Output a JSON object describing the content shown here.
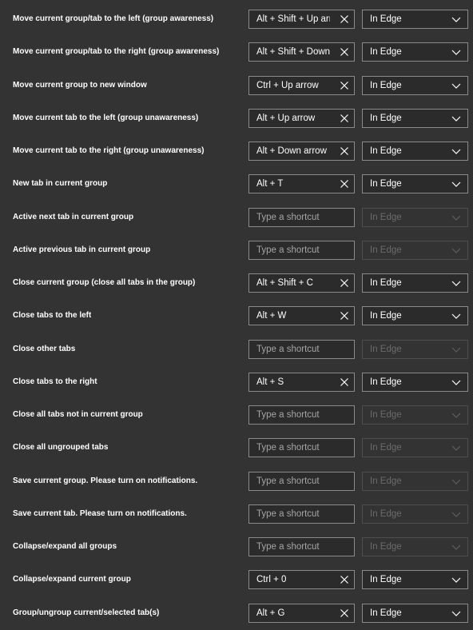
{
  "shortcuts": [
    {
      "label": "Move current group/tab to the left (group awareness)",
      "keys": "Alt + Shift + Up arr",
      "placeholder": "",
      "scope": "In Edge",
      "enabled": true
    },
    {
      "label": "Move current group/tab to the right (group awareness)",
      "keys": "Alt + Shift + Down",
      "placeholder": "",
      "scope": "In Edge",
      "enabled": true
    },
    {
      "label": "Move current group to new window",
      "keys": "Ctrl + Up arrow",
      "placeholder": "",
      "scope": "In Edge",
      "enabled": true
    },
    {
      "label": "Move current tab to the left (group unawareness)",
      "keys": "Alt + Up arrow",
      "placeholder": "",
      "scope": "In Edge",
      "enabled": true
    },
    {
      "label": "Move current tab to the right (group unawareness)",
      "keys": "Alt + Down arrow",
      "placeholder": "",
      "scope": "In Edge",
      "enabled": true
    },
    {
      "label": "New tab in current group",
      "keys": "Alt + T",
      "placeholder": "",
      "scope": "In Edge",
      "enabled": true
    },
    {
      "label": "Active next tab in current group",
      "keys": "",
      "placeholder": "Type a shortcut",
      "scope": "In Edge",
      "enabled": false
    },
    {
      "label": "Active previous tab in current group",
      "keys": "",
      "placeholder": "Type a shortcut",
      "scope": "In Edge",
      "enabled": false
    },
    {
      "label": "Close current group (close all tabs in the group)",
      "keys": "Alt + Shift + C",
      "placeholder": "",
      "scope": "In Edge",
      "enabled": true
    },
    {
      "label": "Close tabs to the left",
      "keys": "Alt + W",
      "placeholder": "",
      "scope": "In Edge",
      "enabled": true
    },
    {
      "label": "Close other tabs",
      "keys": "",
      "placeholder": "Type a shortcut",
      "scope": "In Edge",
      "enabled": false
    },
    {
      "label": "Close tabs to the right",
      "keys": "Alt + S",
      "placeholder": "",
      "scope": "In Edge",
      "enabled": true
    },
    {
      "label": "Close all tabs not in current group",
      "keys": "",
      "placeholder": "Type a shortcut",
      "scope": "In Edge",
      "enabled": false
    },
    {
      "label": "Close all ungrouped tabs",
      "keys": "",
      "placeholder": "Type a shortcut",
      "scope": "In Edge",
      "enabled": false
    },
    {
      "label": "Save current group. Please turn on notifications.",
      "keys": "",
      "placeholder": "Type a shortcut",
      "scope": "In Edge",
      "enabled": false
    },
    {
      "label": "Save current tab. Please turn on notifications.",
      "keys": "",
      "placeholder": "Type a shortcut",
      "scope": "In Edge",
      "enabled": false
    },
    {
      "label": "Collapse/expand all groups",
      "keys": "",
      "placeholder": "Type a shortcut",
      "scope": "In Edge",
      "enabled": false
    },
    {
      "label": "Collapse/expand current group",
      "keys": "Ctrl + 0",
      "placeholder": "",
      "scope": "In Edge",
      "enabled": true
    },
    {
      "label": "Group/ungroup current/selected tab(s)",
      "keys": "Alt + G",
      "placeholder": "",
      "scope": "In Edge",
      "enabled": true
    }
  ],
  "icons": {
    "clear": "close-icon",
    "dropdown": "chevron-down-icon"
  },
  "colors": {
    "background": "#333333",
    "field_border": "#8a8a8a",
    "disabled_text": "#6b6b6b",
    "placeholder_text": "#a5a5a5"
  }
}
